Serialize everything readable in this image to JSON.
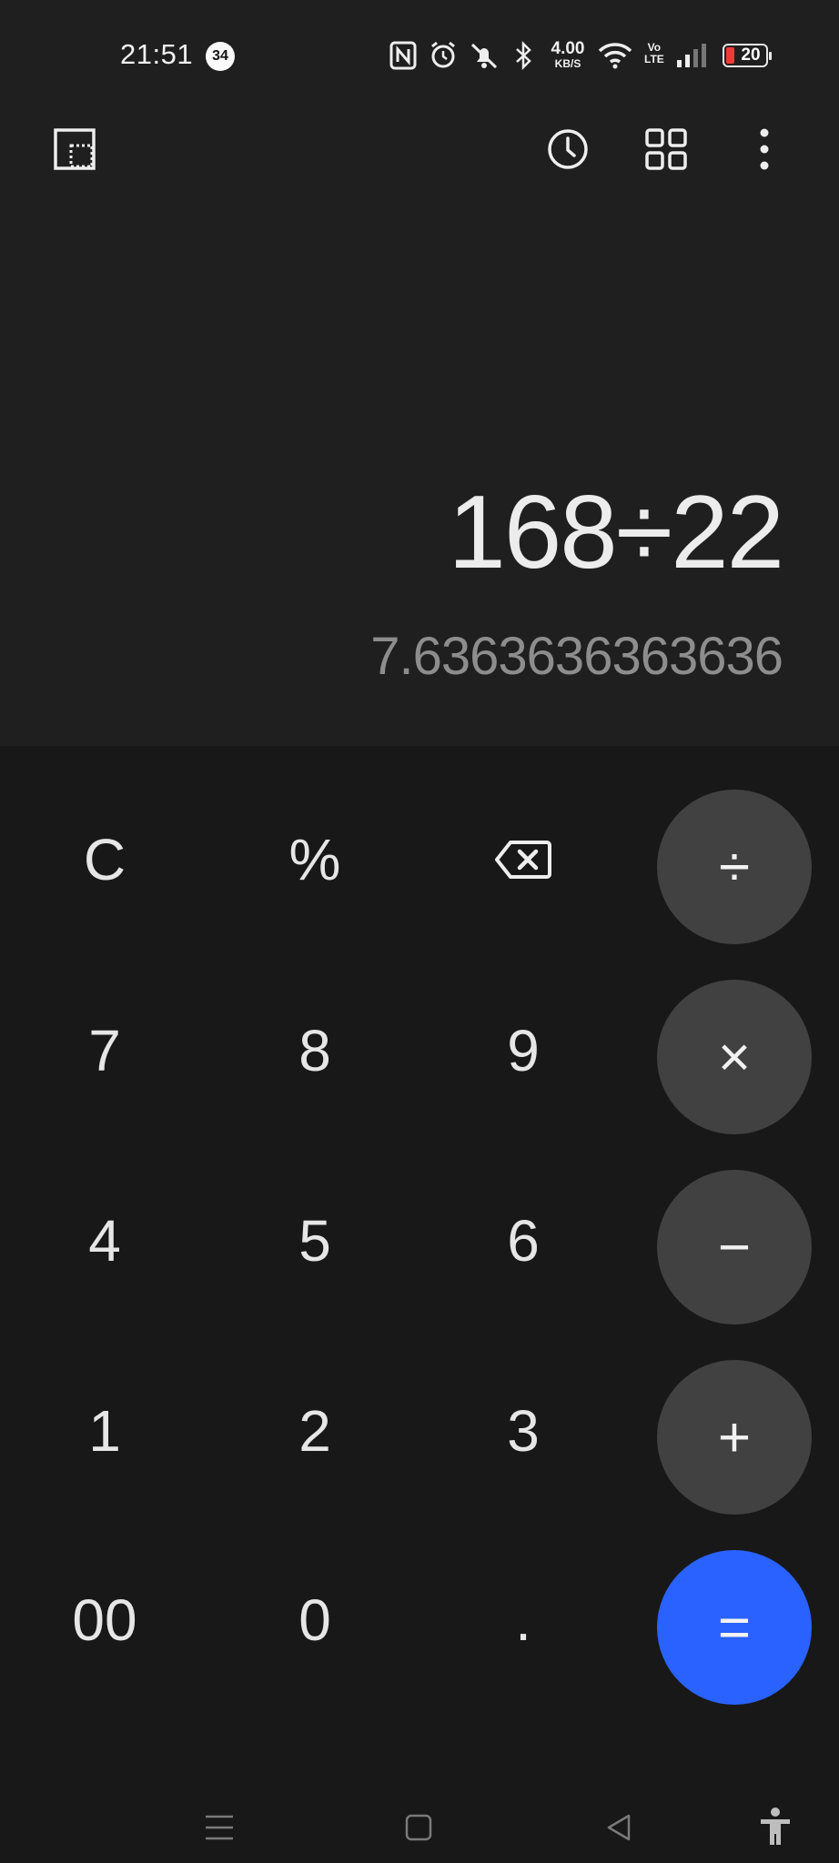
{
  "status_bar": {
    "time": "21:51",
    "notification_count": "34",
    "network_speed_value": "4.00",
    "network_speed_unit": "KB/S",
    "volte_top": "Vo",
    "volte_bottom": "LTE",
    "battery_level": "20",
    "battery_color": "#f03a3a"
  },
  "toolbar": {
    "icons": [
      "picture-in-picture-icon",
      "history-icon",
      "grid-icon",
      "more-vert-icon"
    ]
  },
  "display": {
    "expression": "168÷22",
    "result": "7.6363636363636"
  },
  "keypad": {
    "clear": "C",
    "percent": "%",
    "k7": "7",
    "k8": "8",
    "k9": "9",
    "k4": "4",
    "k5": "5",
    "k6": "6",
    "k1": "1",
    "k2": "2",
    "k3": "3",
    "k00": "00",
    "k0": "0",
    "dot": ".",
    "divide": "÷",
    "multiply": "×",
    "minus": "−",
    "plus": "+",
    "equals": "=",
    "accent_color": "#2962ff",
    "operator_bg": "#414141"
  },
  "nav_bar": {
    "icons": [
      "menu-icon",
      "home-icon",
      "back-icon",
      "accessibility-icon"
    ]
  }
}
